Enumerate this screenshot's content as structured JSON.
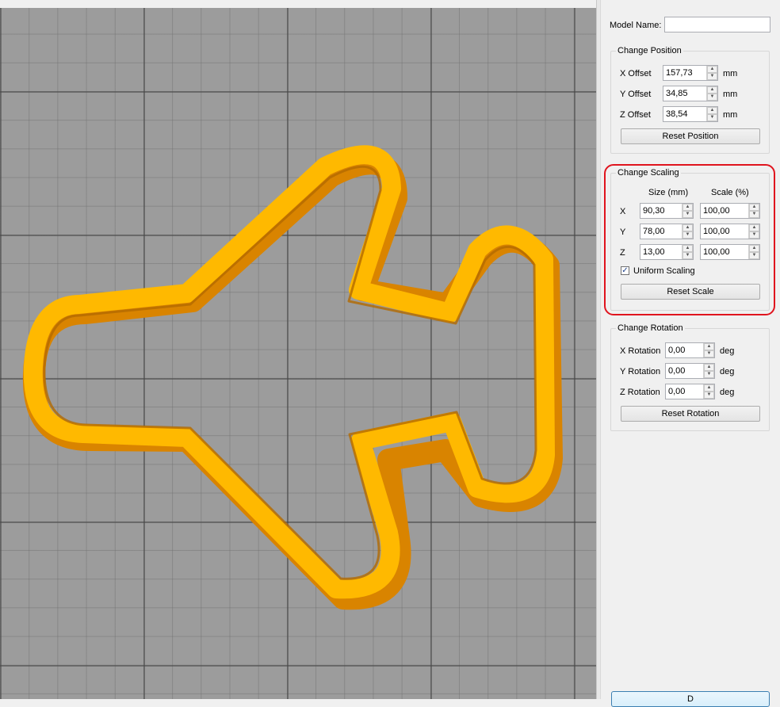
{
  "model_name": {
    "label": "Model Name:",
    "value": ""
  },
  "position": {
    "title": "Change Position",
    "x": {
      "label": "X Offset",
      "value": "157,73",
      "unit": "mm"
    },
    "y": {
      "label": "Y Offset",
      "value": "34,85",
      "unit": "mm"
    },
    "z": {
      "label": "Z Offset",
      "value": "38,54",
      "unit": "mm"
    },
    "reset_label": "Reset Position"
  },
  "scaling": {
    "title": "Change Scaling",
    "size_header": "Size (mm)",
    "scale_header": "Scale (%)",
    "rows": [
      {
        "axis": "X",
        "size": "90,30",
        "scale": "100,00"
      },
      {
        "axis": "Y",
        "size": "78,00",
        "scale": "100,00"
      },
      {
        "axis": "Z",
        "size": "13,00",
        "scale": "100,00"
      }
    ],
    "uniform_label": "Uniform Scaling",
    "uniform_checked": true,
    "reset_label": "Reset Scale"
  },
  "rotation": {
    "title": "Change Rotation",
    "x": {
      "label": "X Rotation",
      "value": "0,00",
      "unit": "deg"
    },
    "y": {
      "label": "Y Rotation",
      "value": "0,00",
      "unit": "deg"
    },
    "z": {
      "label": "Z Rotation",
      "value": "0,00",
      "unit": "deg"
    },
    "reset_label": "Reset Rotation"
  },
  "bottom_button_label": "D",
  "colors": {
    "model_top": "#ffb900",
    "model_side": "#d98400",
    "highlight": "#e0141e",
    "grid_bg": "#9c9c9c"
  }
}
